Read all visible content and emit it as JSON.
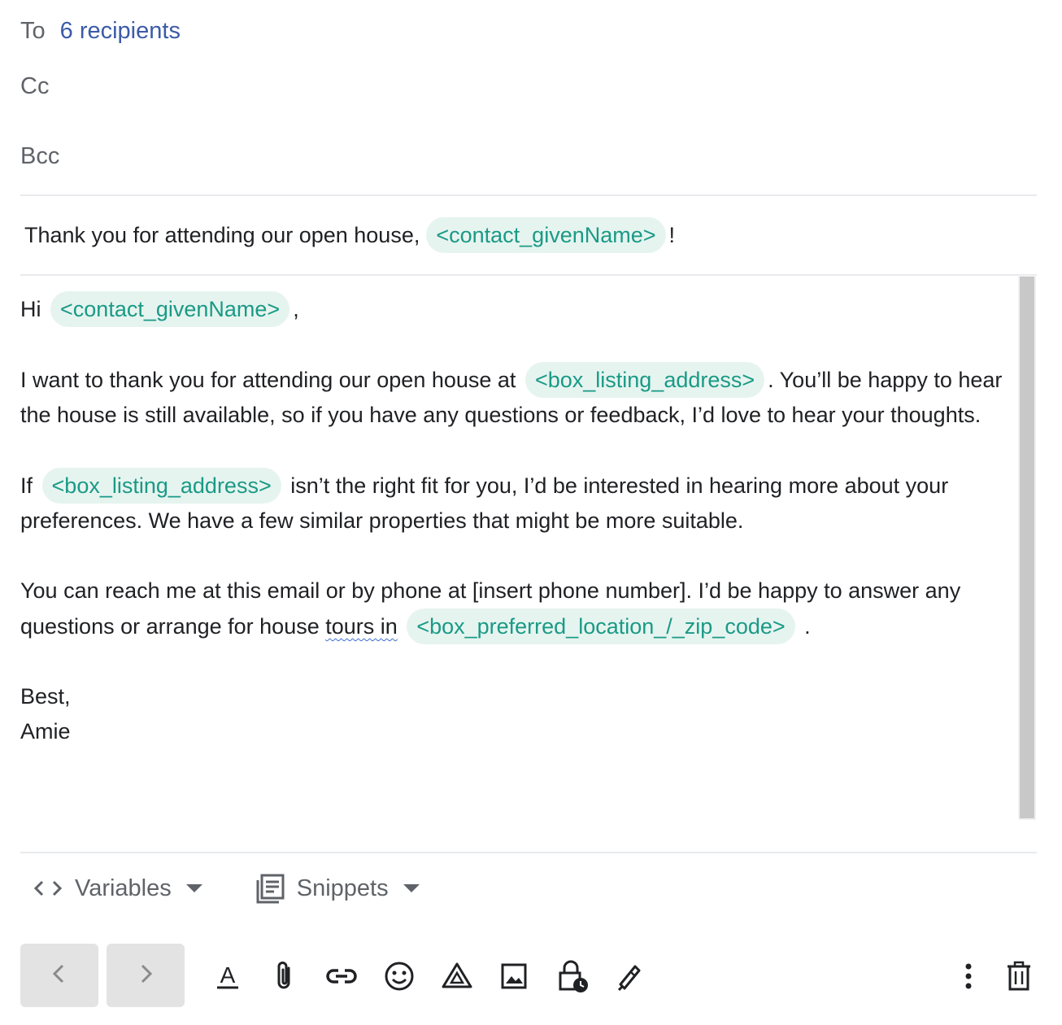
{
  "header": {
    "to_label": "To",
    "recipients": "6 recipients",
    "cc_label": "Cc",
    "bcc_label": "Bcc"
  },
  "subject": {
    "text_before": "Thank you for attending our open house,",
    "variable": "<contact_givenName>",
    "text_after": "!"
  },
  "body": {
    "greeting_word": "Hi",
    "greeting_var": "<contact_givenName>",
    "greeting_after": ",",
    "p1_before": "I want to thank you for attending our open house at",
    "p1_var": "<box_listing_address>",
    "p1_after": ". You’ll be happy to hear the house is still available, so if you have any questions or feedback, I’d love to hear your thoughts.",
    "p2_before": "If",
    "p2_var": "<box_listing_address>",
    "p2_after": "isn’t the right fit for you, I’d be interested in hearing more about your preferences. We have a few similar properties that might be more suitable.",
    "p3_before": "You can reach me at this email or by phone at [insert phone number]. I’d be happy to answer any questions or arrange for house",
    "p3_squiggle": "tours in",
    "p3_var": "<box_preferred_location_/_zip_code>",
    "p3_after": ".",
    "signoff": "Best,",
    "name": "Amie"
  },
  "insert_bar": {
    "variables_label": "Variables",
    "variables_icon": "code-brackets-icon",
    "snippets_label": "Snippets",
    "snippets_icon": "snippets-icon"
  },
  "toolbar": {
    "nav": [
      "chevron-left-icon",
      "chevron-right-icon"
    ],
    "icons": [
      "text-format-icon",
      "attachment-icon",
      "link-icon",
      "emoji-icon",
      "drive-icon",
      "image-icon",
      "confidential-mode-icon",
      "signature-icon",
      "more-options-icon",
      "trash-icon"
    ]
  },
  "colors": {
    "chip_bg": "#e6f4ef",
    "chip_text": "#1a9a86",
    "recipients_link": "#3c5aa8",
    "muted": "#5f6368"
  }
}
